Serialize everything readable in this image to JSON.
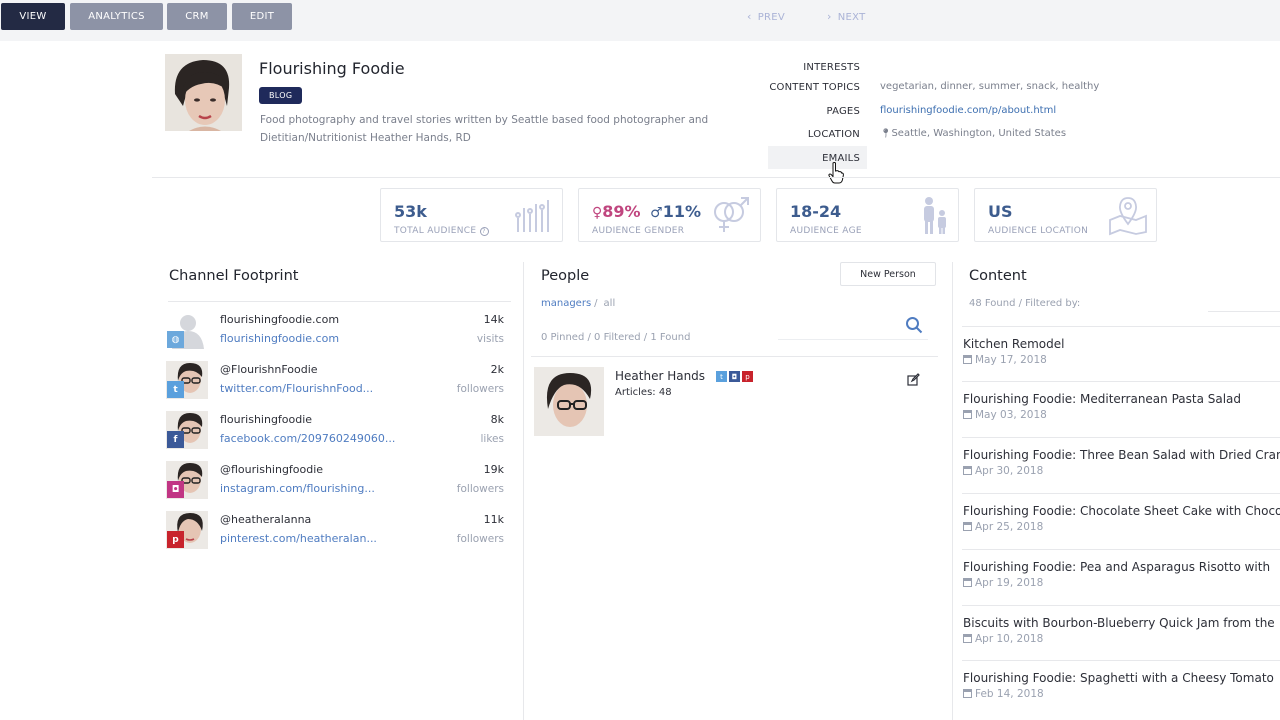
{
  "toolbar": {
    "buttons": [
      {
        "label": "VIEW",
        "active": true
      },
      {
        "label": "ANALYTICS",
        "active": false
      },
      {
        "label": "CRM",
        "active": false
      },
      {
        "label": "EDIT",
        "active": false
      }
    ],
    "prev_label": "PREV",
    "next_label": "NEXT"
  },
  "profile": {
    "name": "Flourishing Foodie",
    "badge": "BLOG",
    "description": "Food photography and travel stories written by Seattle based food photographer and Dietitian/Nutritionist Heather Hands, RD",
    "meta": {
      "interests_label": "INTERESTS",
      "topics_label": "CONTENT TOPICS",
      "topics_value": "vegetarian, dinner, summer, snack, healthy",
      "pages_label": "PAGES",
      "pages_value": "flourishingfoodie.com/p/about.html",
      "location_label": "LOCATION",
      "location_value": "Seattle, Washington, United States",
      "emails_label": "EMAILS"
    }
  },
  "stats": [
    {
      "value": "53k",
      "label": "TOTAL AUDIENCE",
      "icon": "bar-chart-icon"
    },
    {
      "female": "89%",
      "male": "11%",
      "label": "AUDIENCE GENDER",
      "icon": "gender-icon"
    },
    {
      "value": "18-24",
      "label": "AUDIENCE AGE",
      "icon": "family-icon"
    },
    {
      "value": "US",
      "label": "AUDIENCE LOCATION",
      "icon": "map-pin-icon"
    }
  ],
  "colors": {
    "primary": "#232a44",
    "link": "#4f7cc1",
    "female": "#c0467f",
    "male": "#3d5c8e",
    "twitter": "#5aa0dd",
    "facebook": "#3b5998",
    "instagram": "#c13584",
    "pinterest": "#c8232c",
    "web": "#6ca8dc"
  },
  "channels": {
    "title": "Channel Footprint",
    "items": [
      {
        "name": "flourishingfoodie.com",
        "url": "flourishingfoodie.com",
        "count": "14k",
        "unit": "visits",
        "network": "web"
      },
      {
        "name": "@FlourishnFoodie",
        "url": "twitter.com/FlourishnFood...",
        "count": "2k",
        "unit": "followers",
        "network": "twitter"
      },
      {
        "name": "flourishingfoodie",
        "url": "facebook.com/209760249060...",
        "count": "8k",
        "unit": "likes",
        "network": "facebook"
      },
      {
        "name": "@flourishingfoodie",
        "url": "instagram.com/flourishing...",
        "count": "19k",
        "unit": "followers",
        "network": "instagram"
      },
      {
        "name": "@heatheralanna",
        "url": "pinterest.com/heatheralan...",
        "count": "11k",
        "unit": "followers",
        "network": "pinterest"
      }
    ]
  },
  "people": {
    "title": "People",
    "new_button": "New Person",
    "crumb_managers": "managers",
    "crumb_sep": "/",
    "crumb_all": "all",
    "counts": "0 Pinned / 0 Filtered / 1 Found",
    "persons": [
      {
        "name": "Heather Hands",
        "articles": "Articles: 48"
      }
    ]
  },
  "content": {
    "title": "Content",
    "found": "48 Found / Filtered by:",
    "items": [
      {
        "title": "Kitchen Remodel",
        "date": "May 17, 2018"
      },
      {
        "title": "Flourishing Foodie: Mediterranean Pasta Salad",
        "date": "May 03, 2018"
      },
      {
        "title": "Flourishing Foodie: Three Bean Salad with Dried Cran",
        "date": "Apr 30, 2018"
      },
      {
        "title": "Flourishing Foodie: Chocolate Sheet Cake with Chocol",
        "date": "Apr 25, 2018"
      },
      {
        "title": "Flourishing Foodie: Pea and Asparagus Risotto with",
        "date": "Apr 19, 2018"
      },
      {
        "title": "Biscuits with Bourbon-Blueberry Quick Jam from the",
        "date": "Apr 10, 2018"
      },
      {
        "title": "Flourishing Foodie: Spaghetti with a Cheesy Tomato",
        "date": "Feb 14, 2018"
      }
    ]
  }
}
